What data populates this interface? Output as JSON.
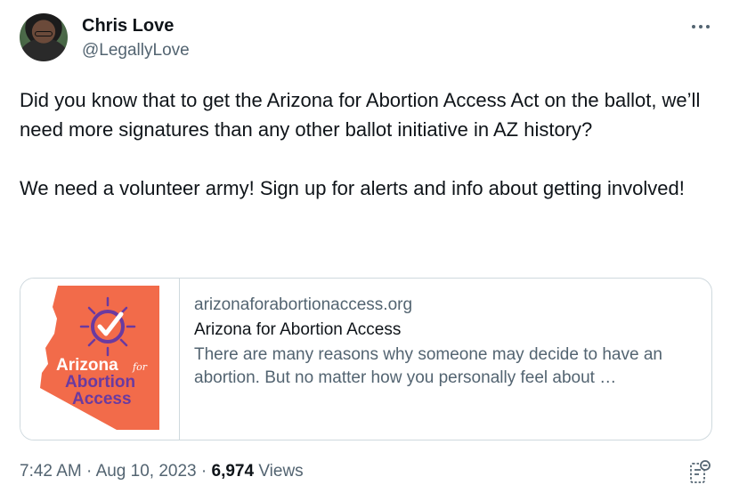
{
  "author": {
    "name": "Chris Love",
    "handle": "@LegallyLove"
  },
  "more_icon": "more-horizontal-icon",
  "tweet": {
    "text": "Did you know that to get the Arizona for Abortion Access Act on the ballot, we’ll need more signatures than any other ballot initiative in AZ history?\n\nWe need a volunteer army! Sign up for alerts and info about getting involved!"
  },
  "card": {
    "logo": {
      "line1": "Arizona",
      "for": "for",
      "line2": "Abortion",
      "line3": "Access",
      "state_color": "#f26b4a",
      "text_color": "#6a3aa0"
    },
    "domain": "arizonaforabortionaccess.org",
    "title": "Arizona for Abortion Access",
    "description": "There are many reasons why someone may decide to have an abortion. But no matter how you personally feel about …"
  },
  "meta": {
    "time": "7:42 AM",
    "separator": "·",
    "date": "Aug 10, 2023",
    "views_count": "6,974",
    "views_label": "Views"
  },
  "colors": {
    "secondary_text": "#536471",
    "border": "#cfd9de"
  }
}
